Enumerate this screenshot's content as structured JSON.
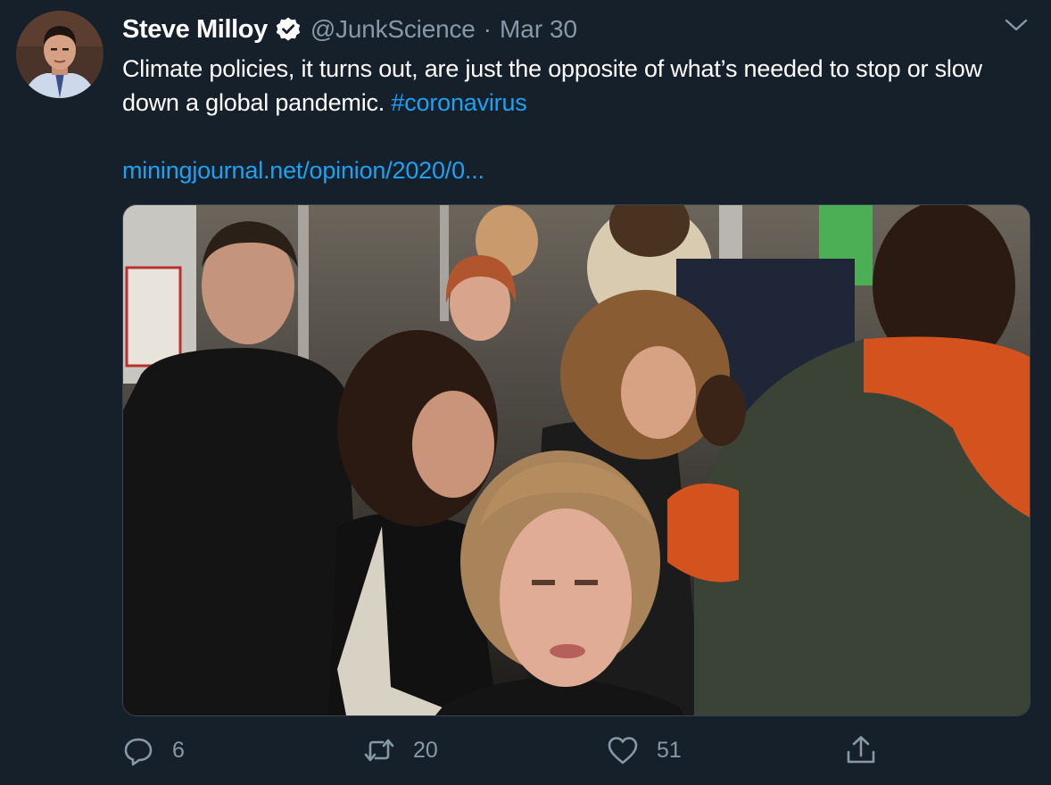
{
  "tweet": {
    "author_name": "Steve Milloy",
    "author_handle": "@JunkScience",
    "separator": "·",
    "date": "Mar 30",
    "text_main": "Climate policies, it turns out, are just the opposite of what’s needed to stop or slow down a global pandemic. ",
    "hashtag": "#coronavirus",
    "link_text": "miningjournal.net/opinion/2020/0...",
    "verified": true
  },
  "actions": {
    "reply_count": "6",
    "retweet_count": "20",
    "like_count": "51"
  },
  "icons": {
    "verified": "verified-badge-icon",
    "caret": "chevron-down-icon",
    "reply": "reply-icon",
    "retweet": "retweet-icon",
    "like": "heart-icon",
    "share": "share-icon"
  },
  "colors": {
    "background": "#15202b",
    "accent": "#1da1f2",
    "muted": "#8899a6",
    "border": "#38444d"
  }
}
